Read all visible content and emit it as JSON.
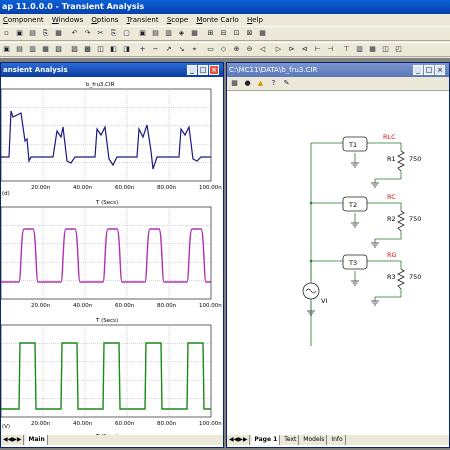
{
  "app": {
    "title": "ap 11.0.0.0 - Transient Analysis"
  },
  "menu": {
    "items": [
      "Component",
      "Windows",
      "Options",
      "Transient",
      "Scope",
      "Monte Carlo",
      "Help"
    ],
    "underline": [
      "C",
      "W",
      "O",
      "T",
      "S",
      "M",
      "H"
    ]
  },
  "transient_window": {
    "title": "ansient Analysis",
    "plot_title": "b_fru3.CIR",
    "x_ticks": [
      "20.00n",
      "40.00n",
      "60.00n",
      "80.00n",
      "100.00n"
    ],
    "x_label": "T (Secs)",
    "y_trace_label_top": "(d)",
    "y_trace_label_bottom": "(V)",
    "colors": {
      "plot1": "#1a1a80",
      "plot2": "#b030b0",
      "plot3": "#1a8a1a"
    }
  },
  "bottom_tabs": {
    "main": "Main"
  },
  "circuit_window": {
    "title": "C:\\MC11\\DATA\\b_fru3.CIR",
    "components": {
      "T1": "T1",
      "T2": "T2",
      "T3": "T3",
      "R1": "R1",
      "R2": "R2",
      "R3": "R3",
      "r1_val": "750",
      "r2_val": "750",
      "r3_val": "750",
      "n1": "RLC",
      "n2": "RC",
      "n3": "RG",
      "source": "VI"
    },
    "tabs": [
      "Page 1",
      "Text",
      "Models",
      "Info"
    ]
  }
}
